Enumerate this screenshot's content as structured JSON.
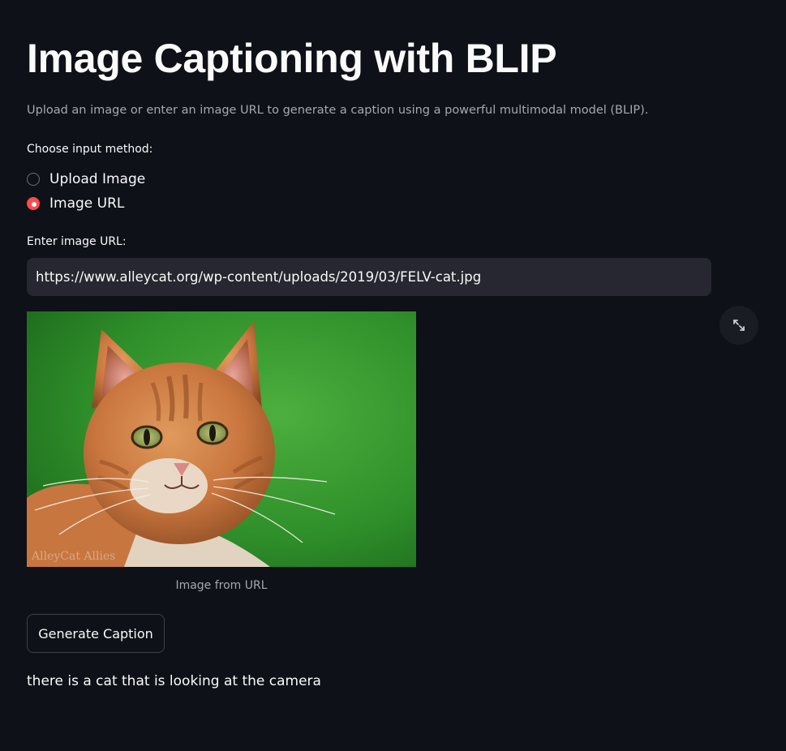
{
  "page": {
    "title": "Image Captioning with BLIP",
    "subtitle": "Upload an image or enter an image URL to generate a caption using a powerful multimodal model (BLIP)."
  },
  "input_method": {
    "label": "Choose input method:",
    "options": [
      {
        "label": "Upload Image",
        "selected": false
      },
      {
        "label": "Image URL",
        "selected": true
      }
    ]
  },
  "url_input": {
    "label": "Enter image URL:",
    "value": "https://www.alleycat.org/wp-content/uploads/2019/03/FELV-cat.jpg"
  },
  "image": {
    "caption": "Image from URL",
    "watermark": "AlleyCat Allies",
    "fullscreen_icon": "expand-icon"
  },
  "generate_button": {
    "label": "Generate Caption"
  },
  "result": {
    "text": "there is a cat that is looking at the camera"
  },
  "colors": {
    "background": "#0e1117",
    "accent": "#ff4b4b",
    "input_bg": "#262730",
    "muted_text": "#a4a8b1"
  }
}
